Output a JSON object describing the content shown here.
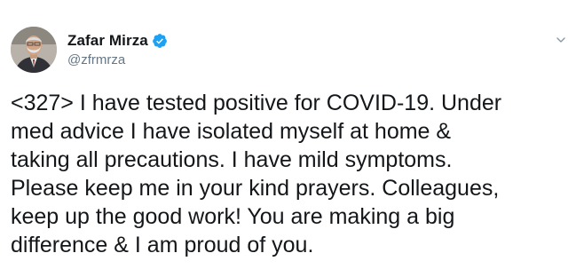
{
  "author": {
    "display_name": "Zafar Mirza",
    "handle": "@zfrmrza",
    "verified": true
  },
  "tweet": {
    "text": "<327> I have tested positive for COVID-19. Under\nmed advice I have isolated myself at home &\ntaking all precautions. I have mild symptoms.\nPlease keep me in your kind prayers. Colleagues,\nkeep up the good work! You are making a big\ndifference & I am proud of you."
  },
  "icons": {
    "verified": "verified-badge-icon",
    "menu": "chevron-down-icon"
  },
  "colors": {
    "verified_blue": "#1da1f2",
    "handle_gray": "#657786",
    "text": "#14171a"
  }
}
